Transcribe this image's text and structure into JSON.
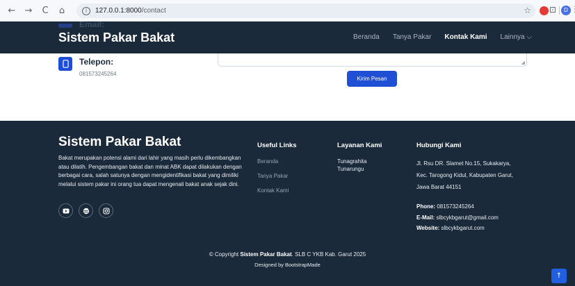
{
  "browser": {
    "back": "←",
    "forward": "→",
    "reload": "C",
    "home": "⌂",
    "url_host": "127.0.0.1:8000",
    "url_path": "/contact",
    "profile_initial": "D"
  },
  "header": {
    "peek_label": "Email:",
    "brand": "Sistem Pakar Bakat",
    "nav": [
      {
        "label": "Beranda"
      },
      {
        "label": "Tanya Pakar"
      },
      {
        "label": "Kontak Kami"
      },
      {
        "label": "Lainnya ⌵"
      }
    ]
  },
  "contact": {
    "phone_label": "Telepon:",
    "phone_value": "081573245264",
    "submit_label": "Kirim Pesan"
  },
  "footer": {
    "brand": "Sistem Pakar Bakat",
    "description": "Bakat merupakan potensi alami dari lahir yang masih perlu dikembangkan atau dilatih. Pengembangan bakat dan minat ABK dapat dilakukan dengan berbagai cara, salah satunya dengan mengidentifikasi bakat yang dimiliki melalui sistem pakar ini orang tua dapat mengenali bakat anak sejak dini.",
    "useful_links_title": "Useful Links",
    "useful_links": [
      "Beranda",
      "Tanya Pakar",
      "Kontak Kami"
    ],
    "layanan_title": "Layanan Kami",
    "layanan": [
      "Tunagrahita",
      "Tunarungu"
    ],
    "hubungi_title": "Hubungi Kami",
    "address_lines": [
      "Jl. Rsu DR. Slamet No.15, Sukakarya,",
      "Kec. Tarogong Kidul, Kabupaten Garut,",
      "Jawa Barat 44151"
    ],
    "phone_label": "Phone:",
    "phone_value": "081573245264",
    "email_label": "E-Mail:",
    "email_value": "slbcykbgarut@gmail.com",
    "website_label": "Website:",
    "website_value": "slbcykbgarut.com",
    "copyright_prefix": "© Copyright",
    "copyright_brand": "Sistem Pakar Bakat",
    "copyright_suffix": ". SLB C YKB Kab. Garut 2025",
    "designed_by": "Designed by BootstrapMade",
    "back_to_top": "↑"
  },
  "icons": {
    "info": "info-icon",
    "phone": "phone-icon",
    "youtube": "youtube-icon",
    "dribbble": "globe-icon",
    "instagram": "instagram-icon"
  },
  "colors": {
    "navy": "#1b2a3b",
    "primary_blue": "#1f4fd4"
  }
}
